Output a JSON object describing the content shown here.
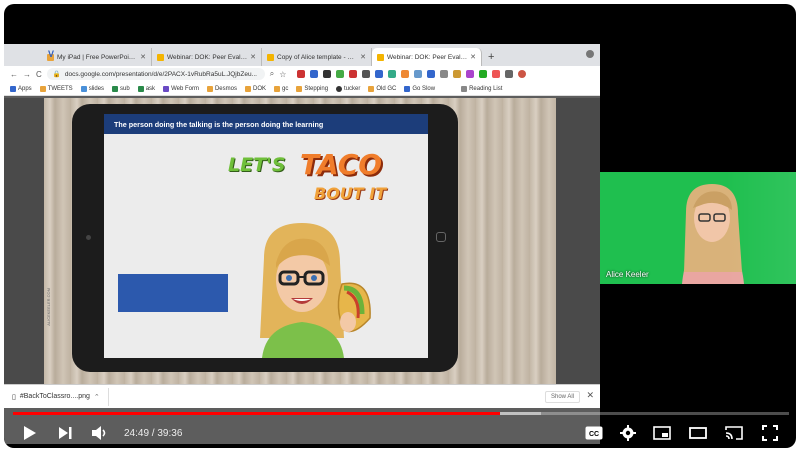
{
  "browser": {
    "tabs": [
      {
        "label": "My iPad | Free PowerPoint tem",
        "color": "#e8a33b"
      },
      {
        "label": "Webinar: DOK: Peer Evaluatio",
        "color": "#f4b400"
      },
      {
        "label": "Copy of Alice template - Goog",
        "color": "#f4b400"
      },
      {
        "label": "Webinar: DOK: Peer Evaluatio",
        "color": "#f4b400",
        "active": true
      }
    ],
    "url": "docs.google.com/presentation/d/e/2PACX-1vRubRa5uL.JQjbZeu...",
    "bookmarks": [
      "Apps",
      "TWEETS",
      "slides",
      "sub",
      "ask",
      "Web Form",
      "Desmos",
      "DOK",
      "gc",
      "Stepping",
      "tucker",
      "Old GC",
      "Go Slow",
      "Reading List"
    ]
  },
  "slide": {
    "banner": "The person doing the talking is the person doing the learning",
    "title_lets": "LET'S",
    "title_taco": "TACO",
    "title_bout": "BOUT IT",
    "watermark": "ALICEKEELER.COM"
  },
  "download": {
    "file": "#BackToClassro....png",
    "show_all": "Show All"
  },
  "webcam": {
    "name": "Alice Keeler"
  },
  "player": {
    "current_time": "24:49",
    "duration": "39:36",
    "time_display": "24:49 / 39:36",
    "progress": 0.627,
    "buffered": 0.68,
    "accent": "#ff0000"
  }
}
